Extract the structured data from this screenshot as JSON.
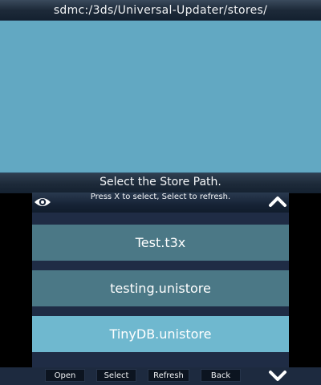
{
  "top_bar": {
    "path": "sdmc:/3ds/Universal-Updater/stores/"
  },
  "instructions": {
    "title": "Select the Store Path.",
    "subtitle": "Press X to select, Select to refresh."
  },
  "files": [
    {
      "name": "Test.t3x",
      "selected": false
    },
    {
      "name": "testing.unistore",
      "selected": false
    },
    {
      "name": "TinyDB.unistore",
      "selected": true
    }
  ],
  "footer": {
    "open_label": "Open",
    "select_label": "Select",
    "refresh_label": "Refresh",
    "back_label": "Back"
  },
  "icons": {
    "eye": "eye-icon",
    "scroll_up": "chevron-up-icon",
    "scroll_down": "chevron-down-icon"
  },
  "colors": {
    "top_background": "#62a8c2",
    "list_item": "#4b7886",
    "list_item_selected": "#6fb8cf",
    "bottom_background": "#1f2c45"
  }
}
